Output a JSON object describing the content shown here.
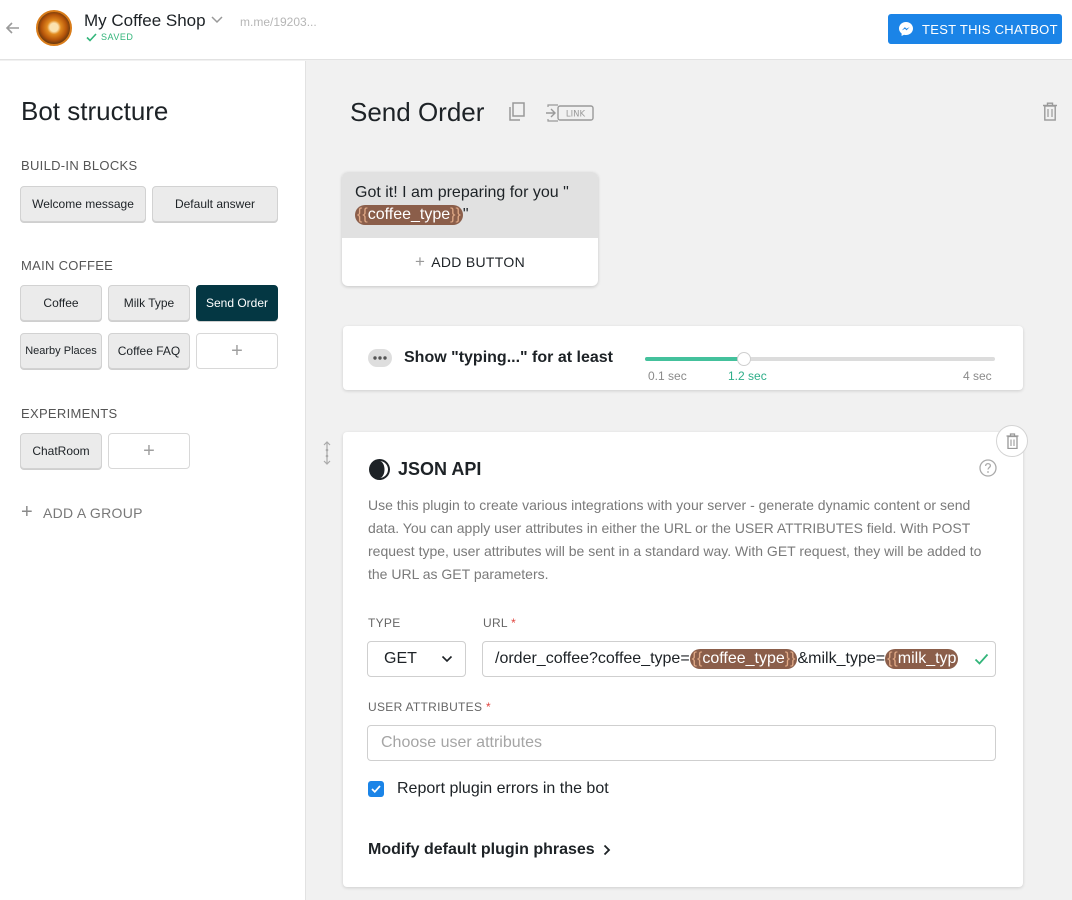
{
  "header": {
    "bot_name": "My Coffee Shop",
    "saved_label": "SAVED",
    "bot_url": "m.me/19203...",
    "test_button": "TEST THIS CHATBOT"
  },
  "sidebar": {
    "title": "Bot structure",
    "groups": [
      {
        "label": "BUILD-IN BLOCKS",
        "blocks": [
          "Welcome message",
          "Default answer"
        ]
      },
      {
        "label": "MAIN COFFEE",
        "blocks": [
          "Coffee",
          "Milk Type",
          "Send Order",
          "Nearby Places",
          "Coffee FAQ"
        ],
        "active": "Send Order"
      },
      {
        "label": "EXPERIMENTS",
        "blocks": [
          "ChatRoom"
        ]
      }
    ],
    "add_group": "ADD A GROUP"
  },
  "block": {
    "title": "Send Order",
    "link_label": "LINK"
  },
  "text_card": {
    "text_prefix": "Got it! I am preparing for you \"",
    "attribute": "coffee_type",
    "text_suffix": "\"",
    "add_button": "ADD BUTTON"
  },
  "typing": {
    "label": "Show \"typing...\" for at least",
    "min_label": "0.1 sec",
    "value_label": "1.2 sec",
    "max_label": "4 sec",
    "min": 0.1,
    "value": 1.2,
    "max": 4
  },
  "json_api": {
    "title": "JSON API",
    "description": "Use this plugin to create various integrations with your server - generate dynamic content or send data. You can apply user attributes in either the URL or the USER ATTRIBUTES field. With POST request type, user attributes will be sent in a standard way. With GET request, they will be added to the URL as GET parameters.",
    "type_label": "TYPE",
    "type_value": "GET",
    "url_label": "URL",
    "url_part1": "/order_coffee?coffee_type=",
    "url_attr1": "coffee_type",
    "url_part2": "&milk_type=",
    "url_attr2": "milk_typ",
    "user_attributes_label": "USER ATTRIBUTES",
    "user_attributes_placeholder": "Choose user attributes",
    "report_errors": "Report plugin errors in the bot",
    "modify_phrases": "Modify default plugin phrases"
  },
  "colors": {
    "accent": "#1b84e7",
    "active_block": "#043743",
    "attribute_chip": "#8b5e4a",
    "slider": "#44c19c",
    "saved": "#32b57a"
  }
}
